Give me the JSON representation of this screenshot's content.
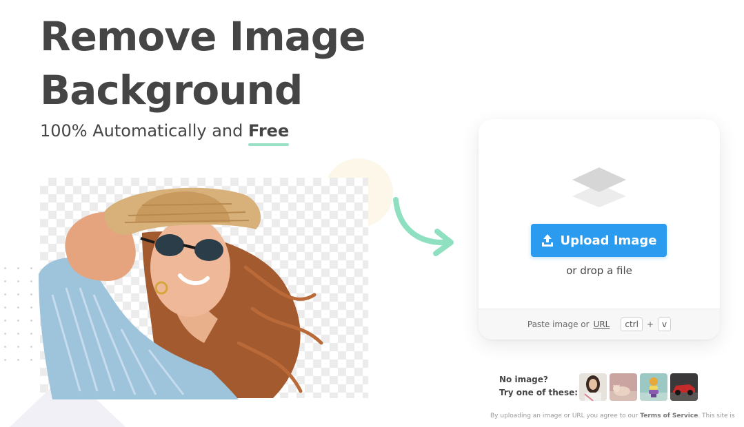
{
  "hero": {
    "title_line1": "Remove Image",
    "title_line2": "Background",
    "subtitle_prefix": "100% Automatically and ",
    "subtitle_emphasis": "Free"
  },
  "upload": {
    "button_label": "Upload Image",
    "drop_text": "or drop a file",
    "paste_text": "Paste image or",
    "url_link": "URL",
    "keys": [
      "ctrl",
      "+",
      "v"
    ]
  },
  "samples": {
    "line1": "No image?",
    "line2": "Try one of these:",
    "items": [
      "sample-portrait",
      "sample-animal",
      "sample-object",
      "sample-car"
    ]
  },
  "terms": {
    "prefix": "By uploading an image or URL you agree to our",
    "link": "Terms of Service",
    "suffix": ". This site is"
  },
  "colors": {
    "accent_blue": "#2b9bf0",
    "underline_green": "#9be0c4",
    "arrow_green": "#8ee0c0",
    "title_gray": "#454545"
  },
  "icons": [
    "upload-icon",
    "layers-icon",
    "curved-arrow-icon"
  ]
}
